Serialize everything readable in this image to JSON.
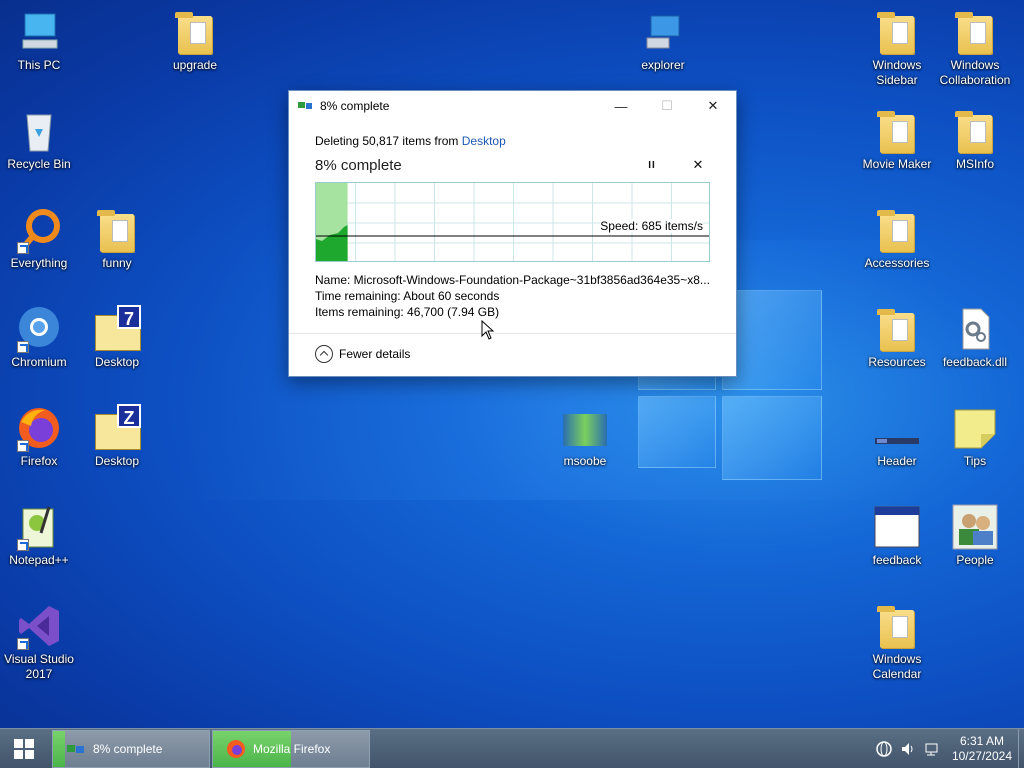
{
  "desktop": {
    "icons_left": [
      {
        "label": "This PC",
        "icon": "computer-icon"
      },
      {
        "label": "upgrade",
        "icon": "folder-icon"
      },
      {
        "label": "Recycle Bin",
        "icon": "recycle-bin-icon"
      },
      {
        "label": "Everything",
        "icon": "everything-search-icon"
      },
      {
        "label": "funny",
        "icon": "folder-icon"
      },
      {
        "label": "Chromium",
        "icon": "chromium-icon"
      },
      {
        "label": "Desktop",
        "icon": "zip-folder-7-icon"
      },
      {
        "label": "Firefox",
        "icon": "firefox-icon"
      },
      {
        "label": "Desktop",
        "icon": "zip-folder-z-icon"
      },
      {
        "label": "Notepad++",
        "icon": "notepadpp-icon"
      },
      {
        "label": "Visual Studio\n2017",
        "icon": "visual-studio-icon"
      }
    ],
    "icons_center": [
      {
        "label": "explorer",
        "icon": "explorer-icon"
      },
      {
        "label": "msoobe",
        "icon": "image-icon"
      }
    ],
    "icons_right": [
      {
        "label": "Windows\nSidebar",
        "icon": "folder-icon"
      },
      {
        "label": "Windows\nCollaboration",
        "icon": "folder-icon"
      },
      {
        "label": "Movie Maker",
        "icon": "folder-icon"
      },
      {
        "label": "MSInfo",
        "icon": "folder-icon"
      },
      {
        "label": "Accessories",
        "icon": "folder-icon"
      },
      {
        "label": "Resources",
        "icon": "folder-icon"
      },
      {
        "label": "feedback.dll",
        "icon": "dll-file-icon"
      },
      {
        "label": "Header",
        "icon": "header-image-icon"
      },
      {
        "label": "Tips",
        "icon": "notepad-icon"
      },
      {
        "label": "feedback",
        "icon": "window-app-icon"
      },
      {
        "label": "People",
        "icon": "people-icon"
      },
      {
        "label": "Windows\nCalendar",
        "icon": "folder-icon"
      }
    ]
  },
  "dialog": {
    "title": "8% complete",
    "minimize": "—",
    "maximize": "☐",
    "close": "✕",
    "deleting_prefix": "Deleting 50,817 items from ",
    "deleting_source": "Desktop",
    "percent_title": "8% complete",
    "pause": "II",
    "stop": "✕",
    "speed": "Speed: 685 items/s",
    "progress_fraction": 0.08,
    "name_row": "Name:  Microsoft-Windows-Foundation-Package~31bf3856ad364e35~x8...",
    "time_row": "Time remaining:  About 60 seconds",
    "items_row": "Items remaining:  46,700 (7.94 GB)",
    "fewer_details": "Fewer details"
  },
  "taskbar": {
    "tasks": [
      {
        "label": "8% complete",
        "icon": "copy-progress-icon",
        "progress": 0.08
      },
      {
        "label": "Mozilla Firefox",
        "icon": "firefox-icon",
        "progress": 0.5
      }
    ],
    "time": "6:31 AM",
    "date": "10/27/2024"
  },
  "colors": {
    "accent_link": "#1c58b5",
    "progress_green": "#4bb54a"
  }
}
